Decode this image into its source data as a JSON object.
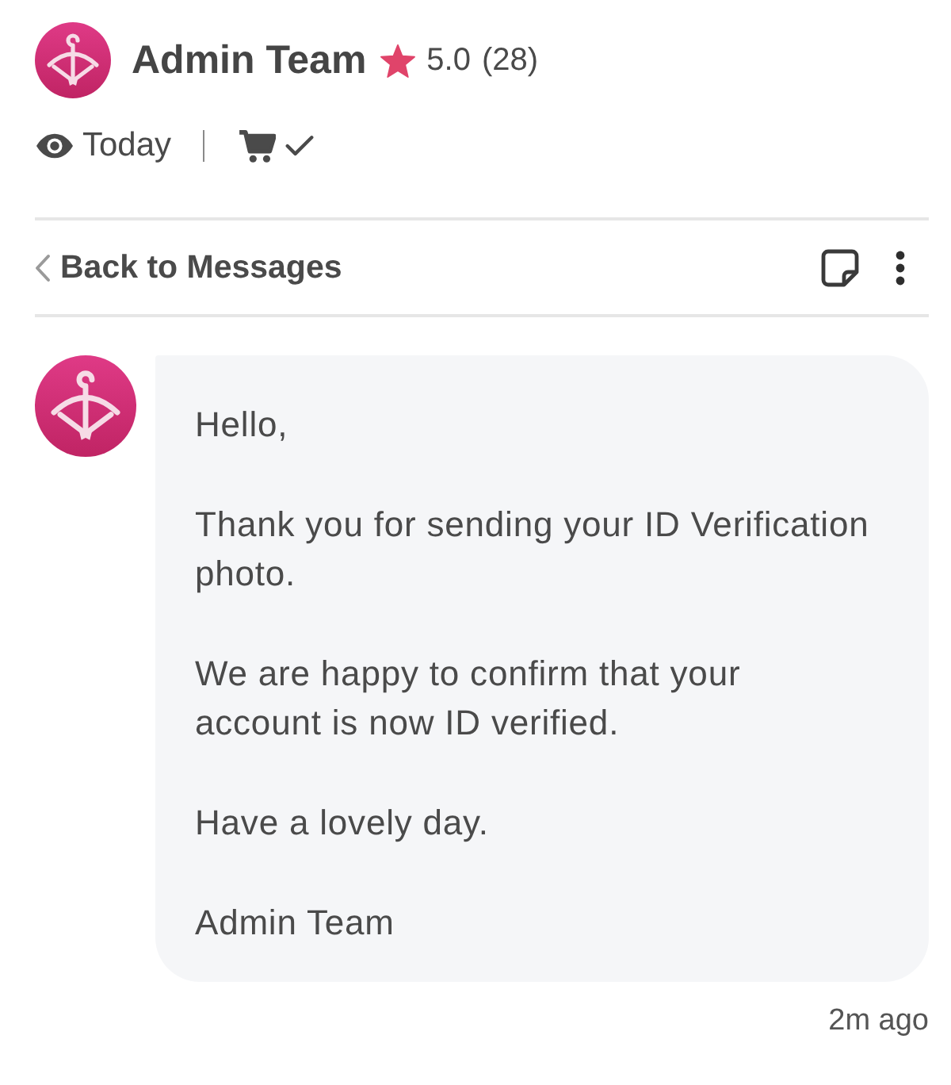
{
  "header": {
    "name": "Admin Team",
    "rating": "5.0",
    "review_count": "(28)",
    "last_seen": "Today"
  },
  "nav": {
    "back_label": "Back to Messages"
  },
  "message": {
    "paragraphs": [
      "Hello,",
      "Thank you for sending your ID Verification photo.",
      "We are happy to confirm that your account is now ID verified.",
      "Have a lovely day.",
      "Admin Team"
    ],
    "time": "2m ago"
  }
}
